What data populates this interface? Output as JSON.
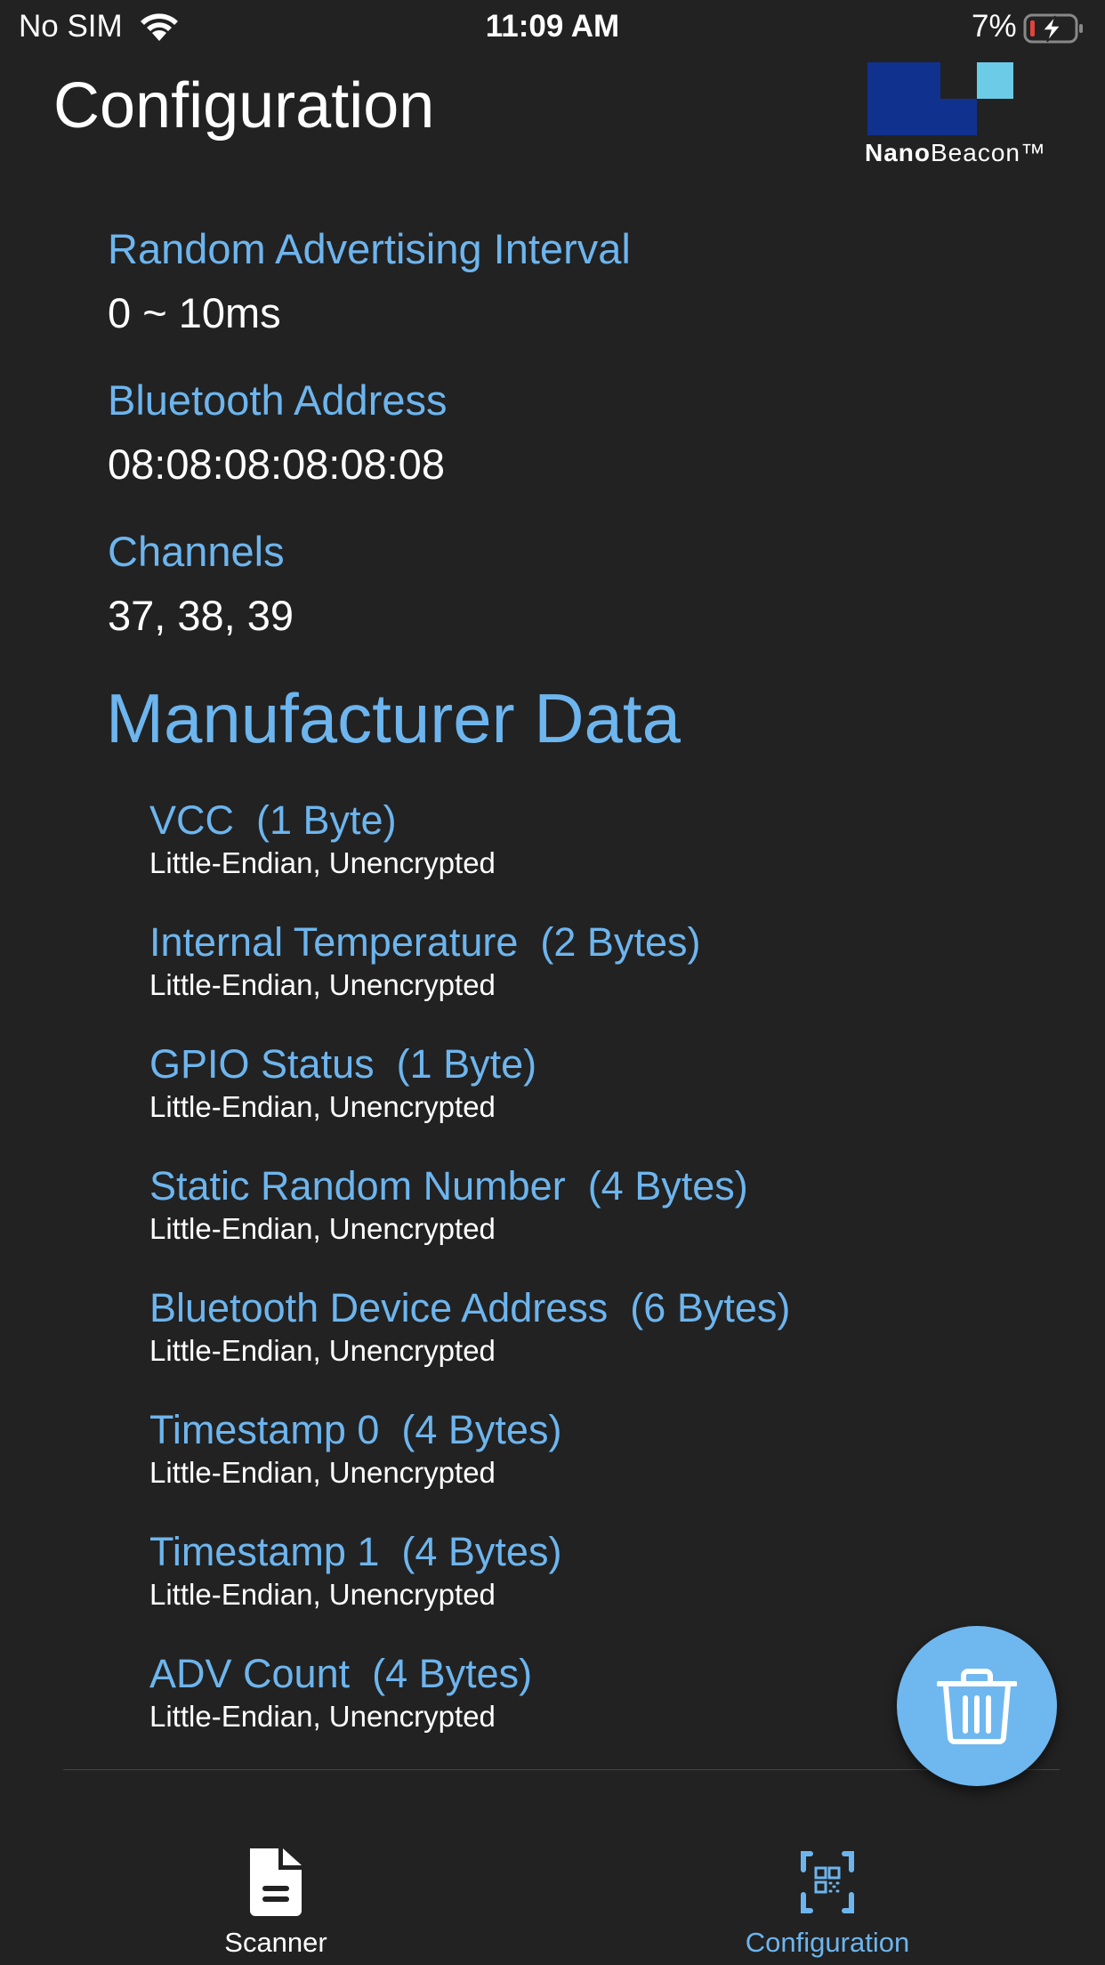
{
  "status_bar": {
    "carrier": "No SIM",
    "wifi_icon": "wifi-icon",
    "time": "11:09 AM",
    "battery_percent": "7%",
    "battery_icon": "battery-charging-icon",
    "battery_level": 0.07,
    "battery_low_color": "#e0443a"
  },
  "header": {
    "title": "Configuration",
    "logo": {
      "brand_bold": "Nano",
      "brand_light": "Beacon™",
      "dark_color": "#11318f",
      "light_color": "#6ccbe6"
    }
  },
  "fields": [
    {
      "label": "Random Advertising Interval",
      "value": "0 ~ 10ms"
    },
    {
      "label": "Bluetooth Address",
      "value": "08:08:08:08:08:08"
    },
    {
      "label": "Channels",
      "value": "37, 38, 39"
    }
  ],
  "manufacturer_data": {
    "title": "Manufacturer Data",
    "items": [
      {
        "name": "VCC  (1 Byte)",
        "desc": "Little-Endian, Unencrypted"
      },
      {
        "name": "Internal Temperature  (2 Bytes)",
        "desc": "Little-Endian, Unencrypted"
      },
      {
        "name": "GPIO Status  (1 Byte)",
        "desc": "Little-Endian, Unencrypted"
      },
      {
        "name": "Static Random Number  (4 Bytes)",
        "desc": "Little-Endian, Unencrypted"
      },
      {
        "name": "Bluetooth Device Address  (6 Bytes)",
        "desc": "Little-Endian, Unencrypted"
      },
      {
        "name": "Timestamp 0  (4 Bytes)",
        "desc": "Little-Endian, Unencrypted"
      },
      {
        "name": "Timestamp 1  (4 Bytes)",
        "desc": "Little-Endian, Unencrypted"
      },
      {
        "name": "ADV Count  (4 Bytes)",
        "desc": "Little-Endian, Unencrypted"
      }
    ]
  },
  "fab": {
    "icon": "trash-icon",
    "color": "#6fb7ef"
  },
  "tab_bar": {
    "tabs": [
      {
        "label": "Scanner",
        "icon": "document-icon",
        "active": false
      },
      {
        "label": "Configuration",
        "icon": "qr-scan-icon",
        "active": true
      }
    ],
    "active_color": "#6db5ee",
    "inactive_color": "#ffffff"
  },
  "colors": {
    "background": "#222222",
    "accent": "#6db5ee",
    "text": "#ffffff"
  }
}
